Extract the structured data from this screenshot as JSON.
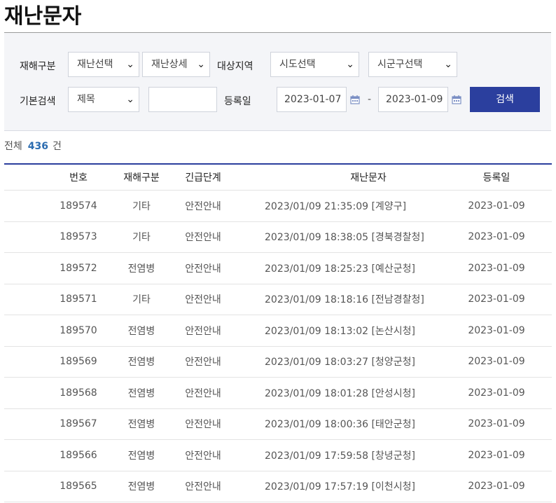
{
  "page": {
    "title": "재난문자"
  },
  "filters": {
    "disaster_type_label": "재해구분",
    "disaster_select": "재난선택",
    "disaster_detail_select": "재난상세",
    "region_label": "대상지역",
    "sido_select": "시도선택",
    "sigungu_select": "시군구선택",
    "basic_search_label": "기본검색",
    "search_field_select": "제목",
    "keyword_value": "",
    "reg_date_label": "등록일",
    "date_from": "2023-01-07",
    "date_sep": "-",
    "date_to": "2023-01-09",
    "search_button": "검색"
  },
  "summary": {
    "prefix": "전체",
    "count": "436",
    "suffix": "건"
  },
  "table": {
    "headers": {
      "no": "번호",
      "type": "재해구분",
      "level": "긴급단계",
      "message": "재난문자",
      "date": "등록일"
    },
    "rows": [
      {
        "no": "189574",
        "type": "기타",
        "level": "안전안내",
        "message": "2023/01/09 21:35:09 [계양구]",
        "date": "2023-01-09"
      },
      {
        "no": "189573",
        "type": "기타",
        "level": "안전안내",
        "message": "2023/01/09 18:38:05 [경북경찰청]",
        "date": "2023-01-09"
      },
      {
        "no": "189572",
        "type": "전염병",
        "level": "안전안내",
        "message": "2023/01/09 18:25:23 [예산군청]",
        "date": "2023-01-09"
      },
      {
        "no": "189571",
        "type": "기타",
        "level": "안전안내",
        "message": "2023/01/09 18:18:16 [전남경찰청]",
        "date": "2023-01-09"
      },
      {
        "no": "189570",
        "type": "전염병",
        "level": "안전안내",
        "message": "2023/01/09 18:13:02 [논산시청]",
        "date": "2023-01-09"
      },
      {
        "no": "189569",
        "type": "전염병",
        "level": "안전안내",
        "message": "2023/01/09 18:03:27 [청양군청]",
        "date": "2023-01-09"
      },
      {
        "no": "189568",
        "type": "전염병",
        "level": "안전안내",
        "message": "2023/01/09 18:01:28 [안성시청]",
        "date": "2023-01-09"
      },
      {
        "no": "189567",
        "type": "전염병",
        "level": "안전안내",
        "message": "2023/01/09 18:00:36 [태안군청]",
        "date": "2023-01-09"
      },
      {
        "no": "189566",
        "type": "전염병",
        "level": "안전안내",
        "message": "2023/01/09 17:59:58 [창녕군청]",
        "date": "2023-01-09"
      },
      {
        "no": "189565",
        "type": "전염병",
        "level": "안전안내",
        "message": "2023/01/09 17:57:19 [이천시청]",
        "date": "2023-01-09"
      }
    ]
  },
  "icons": {
    "calendar": "calendar-icon",
    "dropdown": "chevron-down-icon"
  },
  "colors": {
    "accent": "#2b3f9e",
    "count": "#2b6cb0"
  }
}
